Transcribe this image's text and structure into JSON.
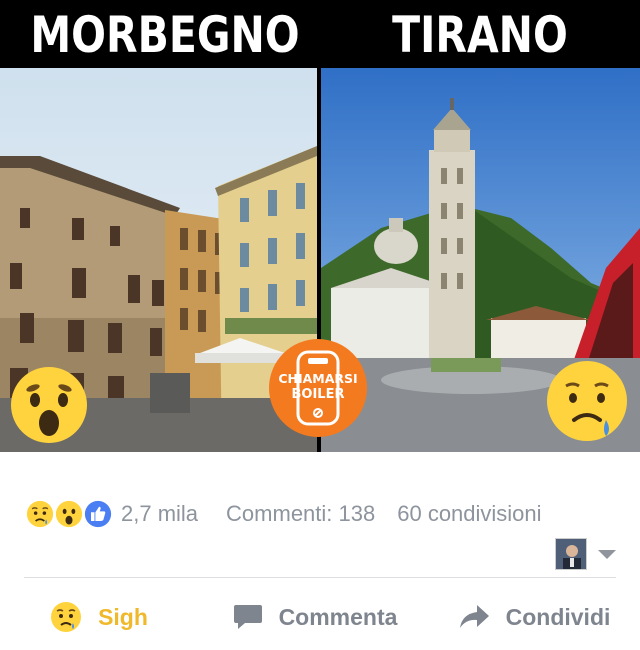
{
  "meme": {
    "left_title": "MORBEGNO",
    "right_title": "TIRANO",
    "logo_line1": "CHIAMARSI",
    "logo_line2": "BOILER",
    "colors": {
      "logo_orange": "#f47a20",
      "emoji_yellow": "#ffd33d",
      "tear_blue": "#4a90e2"
    }
  },
  "reactions": {
    "icons": [
      "sad-icon",
      "wow-icon",
      "like-icon"
    ],
    "count": "2,7 mila",
    "comments": "Commenti: 138",
    "shares": "60 condivisioni"
  },
  "actions": {
    "react_label": "Sigh",
    "comment_label": "Commenta",
    "share_label": "Condividi",
    "colors": {
      "react": "#f0b92b",
      "muted": "#7f858e"
    }
  }
}
